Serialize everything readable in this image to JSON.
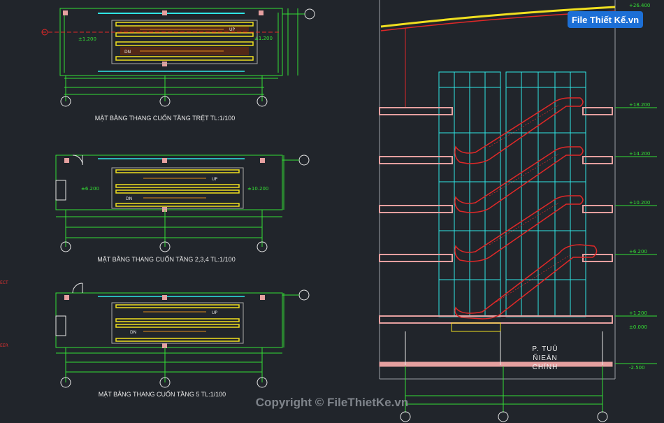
{
  "plans": [
    {
      "title": "MẶT BẰNG THANG CUỐN TẦNG TRỆT TL:1/100",
      "up": "UP",
      "dn": "DN",
      "level": "±1.200",
      "level2": "±1.200"
    },
    {
      "title": "MẶT BẰNG THANG CUỐN TẦNG 2,3,4 TL:1/100",
      "up": "UP",
      "dn": "DN",
      "level": "±6.200",
      "level2": "±10.200"
    },
    {
      "title": "MẶT BẰNG THANG CUỐN TẦNG 5 TL:1/100",
      "up": "UP",
      "dn": "DN",
      "level": "",
      "level2": ""
    }
  ],
  "section": {
    "levels": [
      "+26.400",
      "+18.200",
      "+14.200",
      "+10.200",
      "+6.200",
      "+1.200",
      "±0.000",
      "-2.500"
    ],
    "room": [
      "P. TUÛ",
      "ÑIEÄN",
      "CHÍNH"
    ]
  },
  "side_labels": [
    "ECT",
    "EER"
  ],
  "watermark": "Copyright © FileThietKe.vn",
  "logo": {
    "text": "File Thiết Kế.vn"
  },
  "colors": {
    "bg": "#21252b",
    "green": "#34e034",
    "cyan": "#2fe6e6",
    "red": "#e02828",
    "yellow": "#f0e020",
    "orange": "#e08a1a",
    "magenta": "#e040e0",
    "pink": "#e6a0a0"
  }
}
